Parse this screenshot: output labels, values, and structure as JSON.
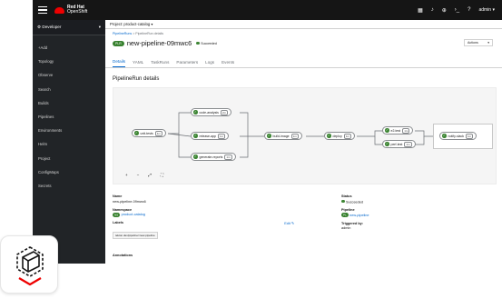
{
  "masthead": {
    "brand_line1": "Red Hat",
    "brand_line2": "OpenShift",
    "user": "admin"
  },
  "sidebar": {
    "perspective": "Developer",
    "items": [
      {
        "label": "+Add"
      },
      {
        "label": "Topology"
      },
      {
        "label": "Observe"
      },
      {
        "label": "Search"
      },
      {
        "label": "Builds"
      },
      {
        "label": "Pipelines"
      },
      {
        "label": "Environments"
      },
      {
        "label": "Helm"
      },
      {
        "label": "Project"
      },
      {
        "label": "ConfigMaps"
      },
      {
        "label": "Secrets"
      }
    ]
  },
  "project_bar": {
    "label": "Project: product-catalog"
  },
  "breadcrumb": {
    "parent": "PipelineRuns",
    "separator": ">",
    "current": "PipelineRun details"
  },
  "header": {
    "badge": "PLR",
    "title": "new-pipeline-09mwc6",
    "status": "Succeeded",
    "actions_label": "Actions"
  },
  "tabs": [
    {
      "label": "Details",
      "active": true
    },
    {
      "label": "YAML",
      "active": false
    },
    {
      "label": "TaskRuns",
      "active": false
    },
    {
      "label": "Parameters",
      "active": false
    },
    {
      "label": "Logs",
      "active": false
    },
    {
      "label": "Events",
      "active": false
    }
  ],
  "section_title": "PipelineRun details",
  "pipeline_graph": {
    "nodes": {
      "unit_tests": {
        "label": "unit-tests",
        "duration": "1m"
      },
      "code_analysis": {
        "label": "code-analysis",
        "duration": "2m"
      },
      "release_app": {
        "label": "release-app",
        "duration": "1m"
      },
      "generate_reports": {
        "label": "generate-reports",
        "duration": "1m"
      },
      "build_image": {
        "label": "build-image",
        "duration": "1m"
      },
      "deploy": {
        "label": "deploy",
        "duration": "1m"
      },
      "e2e_tests": {
        "label": "e2-test",
        "duration": "1m"
      },
      "perf_test": {
        "label": "perf-test",
        "duration": "1m"
      },
      "notify_slack": {
        "label": "notify-slack",
        "duration": "1m"
      }
    },
    "status_color": "#3e8635",
    "zoom_controls": [
      "+",
      "−",
      "⤢",
      "⛶"
    ]
  },
  "details": {
    "name_label": "Name",
    "name_value": "new-pipeline-09mwc6",
    "namespace_label": "Namespace",
    "namespace_badge": "NS",
    "namespace_value": "product-catalog",
    "labels_label": "Labels",
    "edit_label": "Edit",
    "label_chip": "tekton.dev/pipeline=new-pipeline",
    "annotations_label": "Annotations",
    "status_label": "Status",
    "status_value": "Succeeded",
    "pipeline_label": "Pipeline",
    "pipeline_badge": "PL",
    "pipeline_value": "new-pipeline",
    "triggered_label": "Triggered by:",
    "triggered_value": "admin"
  },
  "colors": {
    "masthead": "#151515",
    "sidebar": "#212427",
    "accent": "#0066cc",
    "success": "#3e8635",
    "brand_red": "#ee0000"
  }
}
